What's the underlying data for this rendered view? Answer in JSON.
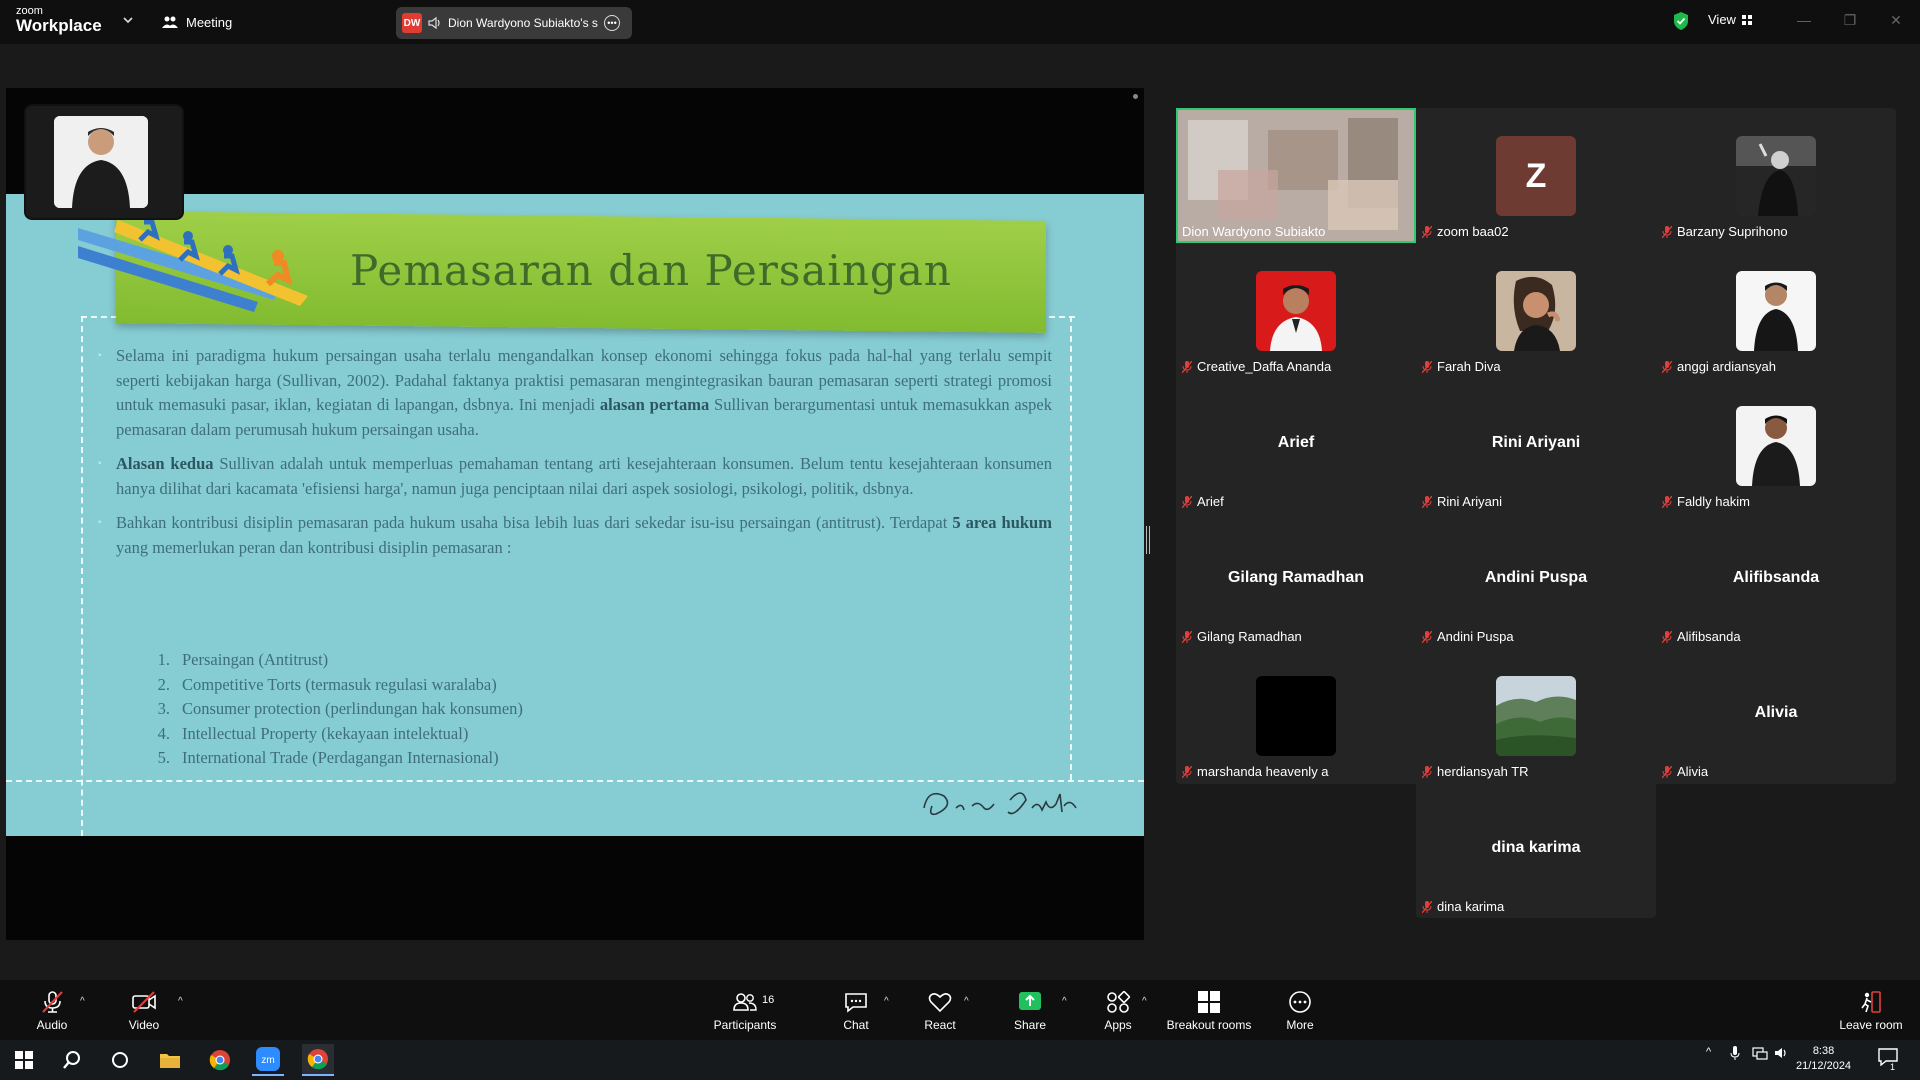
{
  "titlebar": {
    "logo_small": "zoom",
    "logo_big": "Workplace",
    "meeting_label": "Meeting",
    "share_badge": "DW",
    "share_name": "Dion Wardyono Subiakto's s",
    "view_label": "View"
  },
  "slide": {
    "title": "Pemasaran dan Persaingan",
    "p1_a": "Selama ini paradigma hukum persaingan usaha terlalu mengandalkan konsep ekonomi sehingga fokus pada hal-hal yang terlalu sempit seperti kebijakan harga (Sullivan, 2002). Padahal faktanya praktisi pemasaran mengintegrasikan bauran pemasaran seperti strategi promosi untuk memasuki pasar, iklan, kegiatan di lapangan, dsbnya. Ini menjadi ",
    "p1_bold": "alasan pertama",
    "p1_b": " Sullivan berargumentasi untuk memasukkan aspek pemasaran dalam perumusah hukum persaingan usaha.",
    "p2_bold": "Alasan kedua",
    "p2_b": " Sullivan adalah untuk memperluas pemahaman tentang arti kesejahteraan konsumen. Belum tentu kesejahteraan konsumen hanya dilihat dari kacamata 'efisiensi harga', namun juga penciptaan nilai dari aspek sosiologi, psikologi, politik, dsbnya.",
    "p3_a": "Bahkan kontribusi disiplin pemasaran pada hukum usaha bisa lebih luas dari sekedar isu-isu persaingan (antitrust). Terdapat ",
    "p3_bold": "5 area hukum",
    "p3_b": " yang memerlukan peran dan kontribusi disiplin pemasaran :",
    "list": [
      {
        "num": "1.",
        "text": "Persaingan (Antitrust)"
      },
      {
        "num": "2.",
        "text": "Competitive Torts (termasuk regulasi waralaba)"
      },
      {
        "num": "3.",
        "text": "Consumer protection (perlindungan hak konsumen)"
      },
      {
        "num": "4.",
        "text": "Intellectual Property (kekayaan intelektual)"
      },
      {
        "num": "5.",
        "text": "International Trade (Perdagangan Internasional)"
      }
    ],
    "signature": "Dion Subiakto"
  },
  "participants": [
    {
      "name": "Dion Wardyono Subiakto",
      "type": "video",
      "active": true,
      "muted": false
    },
    {
      "name": "zoom baa02",
      "type": "letter",
      "letter": "Z",
      "muted": true
    },
    {
      "name": "Barzany Suprihono",
      "type": "photo",
      "muted": true
    },
    {
      "name": "Creative_Daffa Ananda",
      "type": "photo",
      "muted": true
    },
    {
      "name": "Farah Diva",
      "type": "photo",
      "muted": true
    },
    {
      "name": "anggi ardiansyah",
      "type": "photo",
      "muted": true
    },
    {
      "name": "Arief",
      "type": "name",
      "muted": true
    },
    {
      "name": "Rini Ariyani",
      "type": "name",
      "muted": true
    },
    {
      "name": "Faldly hakim",
      "type": "photo",
      "muted": true
    },
    {
      "name": "Gilang Ramadhan",
      "type": "name",
      "muted": true
    },
    {
      "name": "Andini Puspa",
      "type": "name",
      "muted": true
    },
    {
      "name": "Alifibsanda",
      "type": "name",
      "muted": true
    },
    {
      "name": "marshanda heavenly a",
      "type": "photo",
      "muted": true
    },
    {
      "name": "herdiansyah TR",
      "type": "photo",
      "muted": true
    },
    {
      "name": "Alivia",
      "type": "name",
      "muted": true
    },
    {
      "name": "dina karima",
      "type": "name",
      "muted": true
    }
  ],
  "toolbar": {
    "audio": "Audio",
    "video": "Video",
    "participants": "Participants",
    "participants_count": "16",
    "chat": "Chat",
    "react": "React",
    "share": "Share",
    "apps": "Apps",
    "breakout": "Breakout rooms",
    "more": "More",
    "leave": "Leave room"
  },
  "taskbar": {
    "time": "8:38",
    "date": "21/12/2024",
    "notifications": "1"
  },
  "colors": {
    "accent_green": "#2ecc71",
    "share_green": "#20c05c",
    "muted_red": "#e0403a",
    "slide_bg": "#86cdd3",
    "banner_green": "#8fc33a"
  }
}
